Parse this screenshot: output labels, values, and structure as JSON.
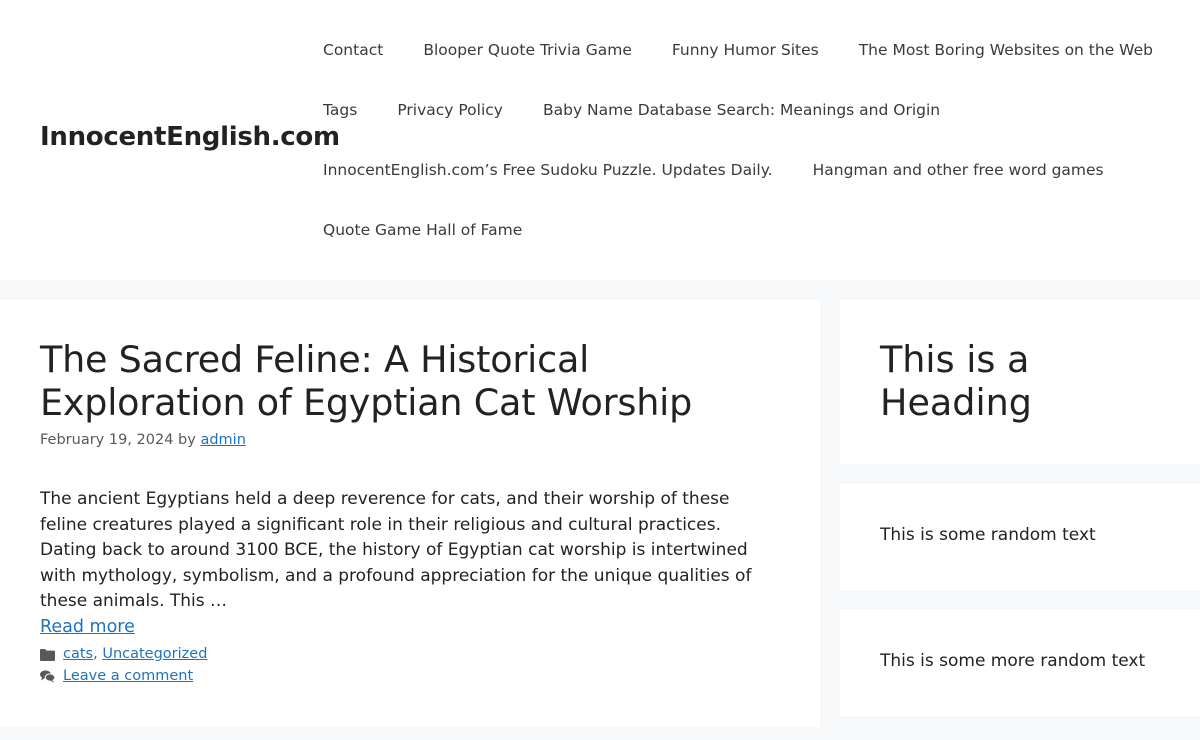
{
  "site": {
    "title": "InnocentEnglish.com"
  },
  "nav": {
    "rows": [
      [
        "Contact",
        "Blooper Quote Trivia Game",
        "Funny Humor Sites",
        "The Most Boring Websites on the Web"
      ],
      [
        "Tags",
        "Privacy Policy",
        "Baby Name Database Search: Meanings and Origin"
      ],
      [
        "InnocentEnglish.com’s Free Sudoku Puzzle. Updates Daily.",
        "Hangman and other free word games"
      ],
      [
        "Quote Game Hall of Fame"
      ]
    ]
  },
  "post": {
    "title": "The Sacred Feline: A Historical Exploration of Egyptian Cat Worship",
    "date": "February 19, 2024",
    "by": "by",
    "author": "admin",
    "excerpt": "The ancient Egyptians held a deep reverence for cats, and their worship of these feline creatures played a significant role in their religious and cultural practices. Dating back to around 3100 BCE, the history of Egyptian cat worship is intertwined with mythology, symbolism, and a profound appreciation for the unique qualities of these animals. This …",
    "read_more": "Read more",
    "categories": [
      "cats",
      "Uncategorized"
    ],
    "category_separator": ",",
    "comment_link": "Leave a comment",
    "icons": {
      "categories": "folder-icon",
      "comments": "comments-icon"
    }
  },
  "sidebar": {
    "heading": "This is a Heading",
    "text1": "This is some random text",
    "text2": "This is some more random text"
  },
  "colors": {
    "link": "#1e73be",
    "background": "#f7f8f9",
    "card": "#ffffff",
    "text": "#222222",
    "meta": "#595959"
  }
}
